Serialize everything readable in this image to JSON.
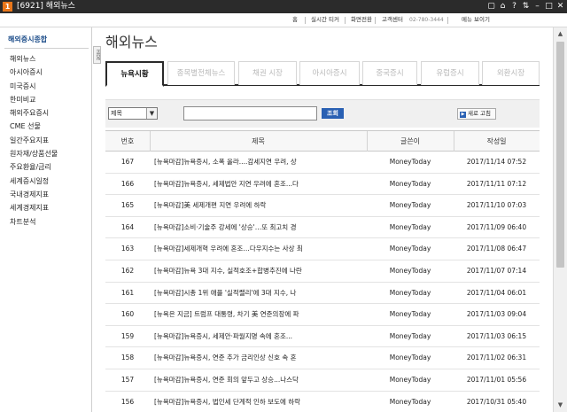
{
  "window": {
    "app_badge": "1",
    "title": "[6921] 해외뉴스",
    "controls": [
      "▢",
      "⌂",
      "?",
      "⇅",
      "–",
      "□",
      "✕"
    ]
  },
  "topbar": {
    "home": "홈",
    "realtime": "실시간 티커",
    "screen_switch": "화면전환",
    "support": "고객센터",
    "phone": "02-780-3444",
    "menu": "메뉴 보이기"
  },
  "sidebar": {
    "heading": "해외증시종합",
    "items": [
      "해외뉴스",
      "아시아증시",
      "미국증시",
      "한미비교",
      "해외주요증시",
      "CME 선물",
      "일간주요지표",
      "원자재/상품선물",
      "주요환율/금리",
      "세계증시일정",
      "국내경제지표",
      "세계경제지표",
      "차트분석"
    ]
  },
  "hide_tab": "HIDE",
  "page_title": "해외뉴스",
  "tabs": [
    "뉴욕시황",
    "종목별전체뉴스",
    "채권 시장",
    "아시아증시",
    "중국증시",
    "유럽증시",
    "외환시장"
  ],
  "search": {
    "select_value": "제목",
    "input_value": "",
    "search_label": "조회",
    "refresh_label": "새로 고침"
  },
  "table": {
    "headers": [
      "번호",
      "제목",
      "글쓴이",
      "작성일"
    ],
    "rows": [
      {
        "no": "167",
        "title": "[뉴욕마감]뉴욕증시, 소폭 올라....감세지연 우려, 상",
        "writer": "MoneyToday",
        "date": "2017/11/14 07:52"
      },
      {
        "no": "166",
        "title": "[뉴욕마감]뉴욕증시, 세제법안 지연 우려에 혼조...다",
        "writer": "MoneyToday",
        "date": "2017/11/11 07:12"
      },
      {
        "no": "165",
        "title": "[뉴욕마감]美 세제개편 지연 우려에 하락",
        "writer": "MoneyToday",
        "date": "2017/11/10 07:03"
      },
      {
        "no": "164",
        "title": "[뉴욕마감]소비·기술주 강세에 '상승'…또 최고치 경",
        "writer": "MoneyToday",
        "date": "2017/11/09 06:40"
      },
      {
        "no": "163",
        "title": "[뉴욕마감]세제개혁 우려에 혼조…다우지수는 사상 최",
        "writer": "MoneyToday",
        "date": "2017/11/08 06:47"
      },
      {
        "no": "162",
        "title": "[뉴욕마감]뉴욕 3대 지수, 실적호조+합병추진에 나란",
        "writer": "MoneyToday",
        "date": "2017/11/07 07:14"
      },
      {
        "no": "161",
        "title": "[뉴욕마감]시총 1위 애플 '실적랠리'에 3대 지수, 나",
        "writer": "MoneyToday",
        "date": "2017/11/04 06:01"
      },
      {
        "no": "160",
        "title": "[뉴욕은 지금] 트럼프 대통령, 차기 美 연준의장에 파",
        "writer": "MoneyToday",
        "date": "2017/11/03 09:04"
      },
      {
        "no": "159",
        "title": "[뉴욕마감]뉴욕증시, 세제안·파월지명 속에 혼조...",
        "writer": "MoneyToday",
        "date": "2017/11/03 06:15"
      },
      {
        "no": "158",
        "title": "[뉴욕마감]뉴욕증시, 연준 추가 금리인상 신호 속 혼",
        "writer": "MoneyToday",
        "date": "2017/11/02 06:31"
      },
      {
        "no": "157",
        "title": "[뉴욕마감]뉴욕증시, 연준 회의 앞두고 상승...나스닥",
        "writer": "MoneyToday",
        "date": "2017/11/01 05:56"
      },
      {
        "no": "156",
        "title": "[뉴욕마감]뉴욕증시, 법인세 단계적 인하 보도에 하락",
        "writer": "MoneyToday",
        "date": "2017/10/31 05:40"
      }
    ]
  }
}
